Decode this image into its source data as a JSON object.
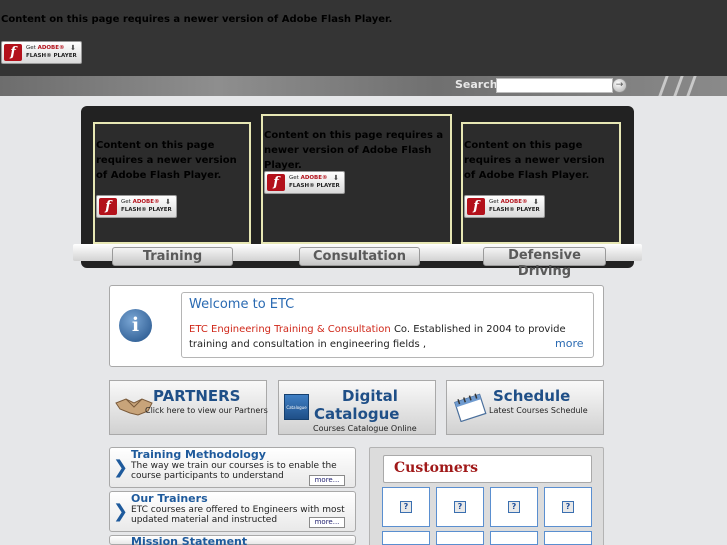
{
  "flash": {
    "message": "Content on this page requires a newer version of Adobe Flash Player.",
    "badge_get": "Get",
    "badge_brand": "ADOBE®",
    "badge_product": "FLASH® PLAYER"
  },
  "search": {
    "label": "Search",
    "value": "",
    "button": "→"
  },
  "banner": {
    "tabs": [
      {
        "label": "Training"
      },
      {
        "label": "Consultation"
      },
      {
        "label": "Defensive Driving"
      }
    ]
  },
  "welcome": {
    "title": "Welcome to ETC",
    "company": "ETC Engineering Training & Consultation",
    "text": " Co. Established in 2004 to provide training and consultation in engineering fields ,",
    "more": "more"
  },
  "tiles": [
    {
      "title": "PARTNERS",
      "subtitle": "Click here to view our Partners",
      "icon": "handshake-icon"
    },
    {
      "title": "Digital Catalogue",
      "title_line1": "Digital",
      "title_line2": "Catalogue",
      "subtitle": "Courses Catalogue Online",
      "icon": "catalogue-icon",
      "icon_text": "Catalogue"
    },
    {
      "title": "Schedule",
      "subtitle": "Latest Courses Schedule",
      "icon": "calendar-icon"
    }
  ],
  "info_rows": [
    {
      "title": "Training Methodology",
      "text": "The way we train our courses is to enable the course participants to understand",
      "more": "more..."
    },
    {
      "title": "Our Trainers",
      "text": "ETC courses are offered to Engineers with most updated material and instructed",
      "more": "more..."
    },
    {
      "title": "Mission Statement",
      "text": "",
      "more": ""
    }
  ],
  "customers": {
    "title": "Customers",
    "logo_placeholder": "?"
  },
  "colors": {
    "top_bar": "#343434",
    "accent_blue": "#1f4f87",
    "link_blue": "#2a6ab2",
    "highlight_red": "#d0281a",
    "customers_title": "#a01818",
    "panel_border": "#e7e7b4"
  }
}
